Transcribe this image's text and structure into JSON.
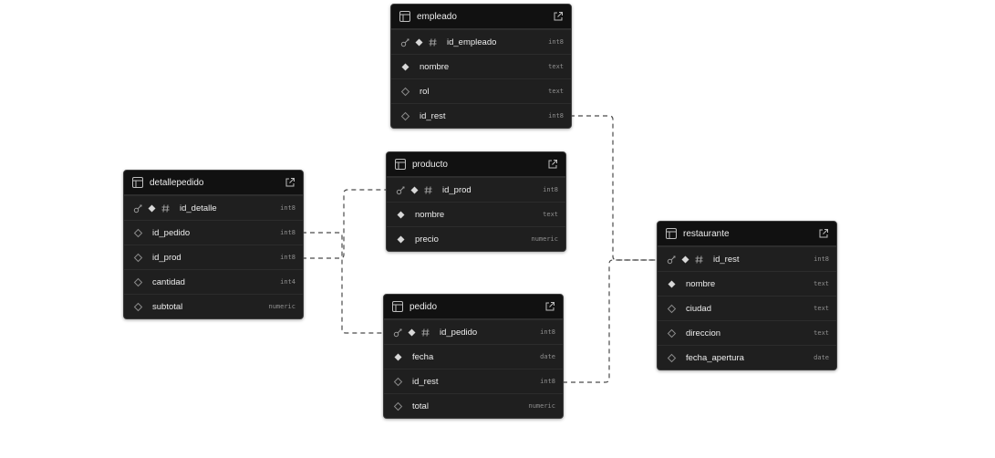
{
  "icons": {
    "key": "key-icon",
    "not_null": "filled-diamond-icon",
    "nullable": "hollow-diamond-icon",
    "identity": "hash-icon",
    "table": "table-icon",
    "open": "external-link-icon"
  },
  "colors": {
    "table_bg": "#1c1c1c",
    "header_bg": "#111111",
    "border": "#3b3b3b",
    "text": "#ededed",
    "type_text": "#8f8f8f",
    "link": "#4a4a4a"
  },
  "tables": {
    "empleado": {
      "name": "empleado",
      "columns": [
        {
          "name": "id_empleado",
          "type": "int8"
        },
        {
          "name": "nombre",
          "type": "text"
        },
        {
          "name": "rol",
          "type": "text"
        },
        {
          "name": "id_rest",
          "type": "int8"
        }
      ]
    },
    "producto": {
      "name": "producto",
      "columns": [
        {
          "name": "id_prod",
          "type": "int8"
        },
        {
          "name": "nombre",
          "type": "text"
        },
        {
          "name": "precio",
          "type": "numeric"
        }
      ]
    },
    "detallepedido": {
      "name": "detallepedido",
      "columns": [
        {
          "name": "id_detalle",
          "type": "int8"
        },
        {
          "name": "id_pedido",
          "type": "int8"
        },
        {
          "name": "id_prod",
          "type": "int8"
        },
        {
          "name": "cantidad",
          "type": "int4"
        },
        {
          "name": "subtotal",
          "type": "numeric"
        }
      ]
    },
    "pedido": {
      "name": "pedido",
      "columns": [
        {
          "name": "id_pedido",
          "type": "int8"
        },
        {
          "name": "fecha",
          "type": "date"
        },
        {
          "name": "id_rest",
          "type": "int8"
        },
        {
          "name": "total",
          "type": "numeric"
        }
      ]
    },
    "restaurante": {
      "name": "restaurante",
      "columns": [
        {
          "name": "id_rest",
          "type": "int8"
        },
        {
          "name": "nombre",
          "type": "text"
        },
        {
          "name": "ciudad",
          "type": "text"
        },
        {
          "name": "direccion",
          "type": "text"
        },
        {
          "name": "fecha_apertura",
          "type": "date"
        }
      ]
    }
  },
  "relationships": [
    {
      "from": "empleado.id_rest",
      "to": "restaurante.id_rest"
    },
    {
      "from": "pedido.id_rest",
      "to": "restaurante.id_rest"
    },
    {
      "from": "detallepedido.id_pedido",
      "to": "pedido.id_pedido"
    },
    {
      "from": "detallepedido.id_prod",
      "to": "producto.id_prod"
    }
  ]
}
